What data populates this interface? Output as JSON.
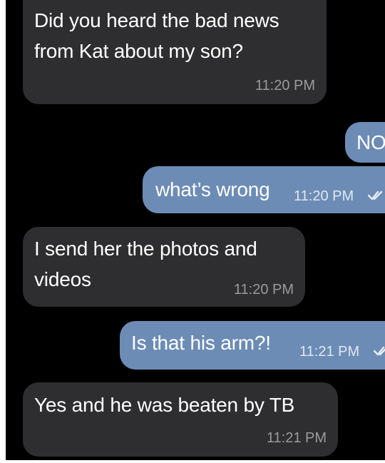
{
  "messages": [
    {
      "direction": "incoming",
      "lines": [
        "Did you heard the bad news",
        "from Kat about my son?"
      ],
      "time": "11:20 PM"
    },
    {
      "direction": "outgoing",
      "text": "NO"
    },
    {
      "direction": "outgoing",
      "text": "what’s wrong",
      "time": "11:20 PM",
      "status_icon": "double-check-icon"
    },
    {
      "direction": "incoming",
      "lines": [
        "I send her the photos and",
        "videos"
      ],
      "time": "11:20 PM"
    },
    {
      "direction": "outgoing",
      "text": "Is that his arm?!",
      "time": "11:21 PM",
      "status_icon": "double-check-icon"
    },
    {
      "direction": "incoming",
      "lines": [
        "Yes and he was beaten by TB"
      ],
      "time": "11:21 PM"
    }
  ],
  "colors": {
    "background": "#000000",
    "incoming_bubble": "#2e2e30",
    "outgoing_bubble": "#6c8cb5"
  }
}
